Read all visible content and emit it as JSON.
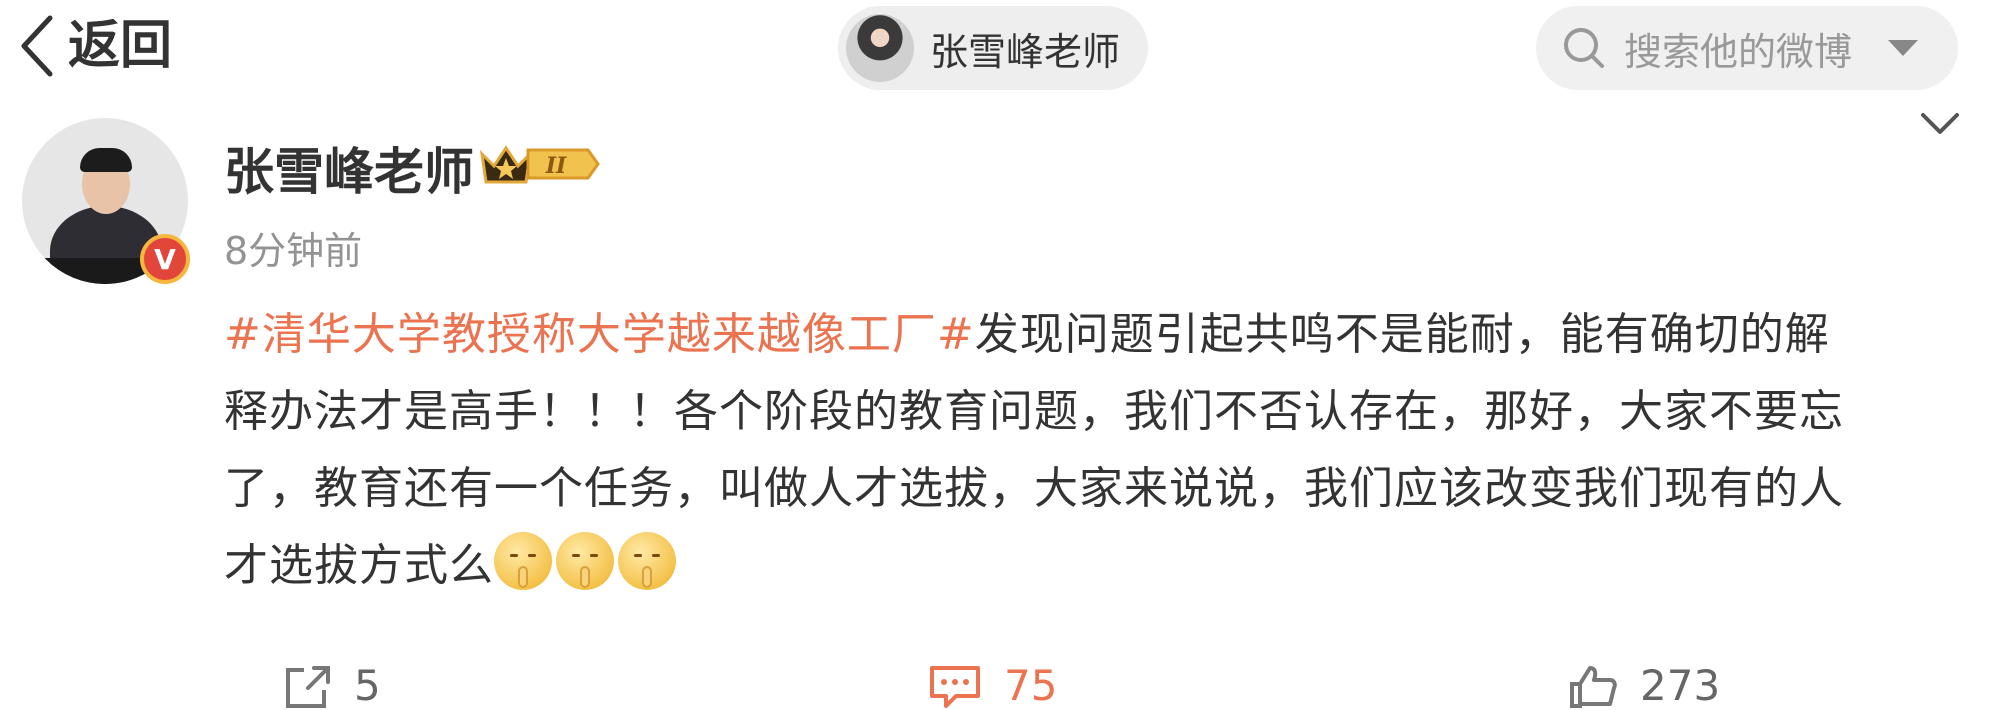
{
  "nav": {
    "back_label": "返回",
    "account_name": "张雪峰老师",
    "search_placeholder": "搜索他的微博"
  },
  "post": {
    "author": "张雪峰老师",
    "verified_badge": "V",
    "rank_badge": "II",
    "time": "8分钟前",
    "topic": "#清华大学教授称大学越来越像工厂#",
    "text_lines": [
      "发现问题引起共鸣不是能耐，能有确切的解",
      "释办法才是高手！！！各个阶段的教育问题，我们不否认存在，那好，大家不要忘",
      "了，教育还有一个任务，叫做人才选拔，大家来说说，我们应该改变我们现有的人",
      "才选拔方式么"
    ],
    "emoji_count": 3
  },
  "actions": {
    "repost_count": "5",
    "comment_count": "75",
    "like_count": "273"
  },
  "colors": {
    "topic": "#eb7350",
    "comment_active": "#eb7350",
    "text": "#333333",
    "muted": "#939393",
    "pill_bg": "#eeeeee"
  },
  "icons": {
    "back": "chevron-left-icon",
    "search": "search-icon",
    "dropdown": "caret-down-icon",
    "more": "chevron-down-icon",
    "repost": "repost-icon",
    "comment": "comment-icon",
    "like": "thumbs-up-icon",
    "emoji": "shush-emoji-icon"
  }
}
